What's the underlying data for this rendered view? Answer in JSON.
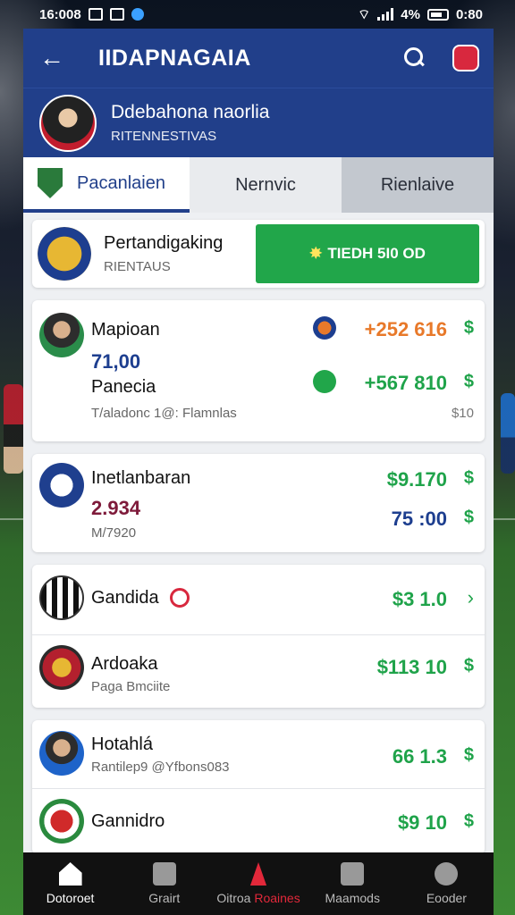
{
  "status_bar": {
    "time": "16:008",
    "battery": "4%",
    "clock": "0:80"
  },
  "header": {
    "title": "IIDAPNAGAIA"
  },
  "profile": {
    "name": "Ddebahona naorlia",
    "subtitle": "RITENNESTIVAS"
  },
  "tabs": [
    {
      "label": "Pacanlaien"
    },
    {
      "label": "Nernvic"
    },
    {
      "label": "Rienlaive"
    }
  ],
  "league": {
    "name": "Pertandigaking",
    "subtitle": "RIENTAUS",
    "cta": "TIEDH 5I0 OD"
  },
  "cards": {
    "c1": {
      "name": "Mapioan",
      "score": "71,00",
      "sub_name": "Panecia",
      "meta": "T/aladonc 1@: Flamnlas",
      "odds1": "+252 616",
      "odds2": "+567 810",
      "right_note": "$10",
      "currency": "$"
    },
    "c2": {
      "name": "Inetlanbaran",
      "score": "2.934",
      "sub": "M/7920",
      "odds1": "$9.170",
      "odds2": "75 :00",
      "currency": "$"
    },
    "c3": {
      "row1_name": "Gandida",
      "row1_odds": "$3 1.0",
      "row1_chev": "›",
      "row2_name": "Ardoaka",
      "row2_sub": "Paga Bmciite",
      "row2_odds": "$113 10",
      "currency": "$"
    },
    "c4": {
      "row1_name": "Hotahlá",
      "row1_sub": "Rantilep9 @Yfbons083",
      "row1_odds": "66 1.3",
      "row2_name": "Gannidro",
      "row2_odds": "$9 10",
      "currency": "$"
    }
  },
  "bottom_nav": [
    {
      "label": "Dotoroet"
    },
    {
      "label": "Grairt"
    },
    {
      "label": "Oitroa",
      "alert": "Roaines"
    },
    {
      "label": "Maamods"
    },
    {
      "label": "Eooder"
    }
  ]
}
